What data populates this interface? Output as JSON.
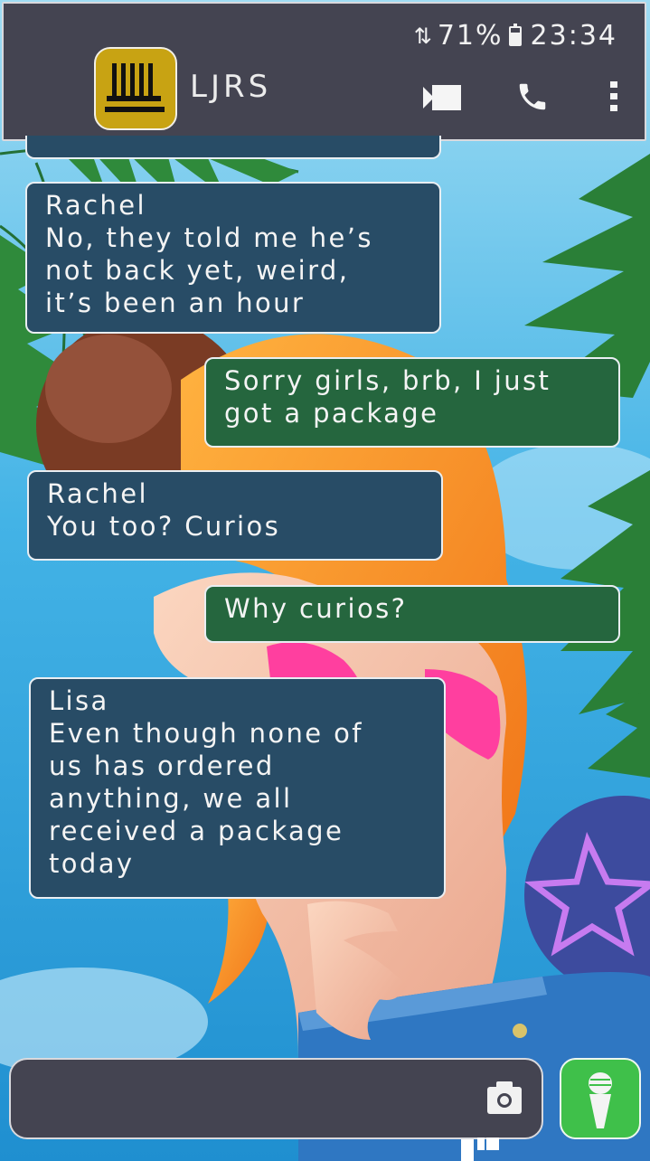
{
  "status_bar": {
    "battery_percent": "71%",
    "time": "23:34",
    "icons": [
      "signal-arrows-icon",
      "battery-icon"
    ]
  },
  "header": {
    "contact_name": "LJRS",
    "avatar_icon": "comb-logo-icon",
    "actions": [
      "video-call-icon",
      "phone-icon",
      "more-vert-icon"
    ]
  },
  "messages": [
    {
      "from": "them",
      "sender": "Rachel",
      "text": "No, they told me he’s\nnot back yet, weird,\nit’s been an hour"
    },
    {
      "from": "me",
      "sender": "",
      "text": "Sorry girls, brb, I just\ngot a package"
    },
    {
      "from": "them",
      "sender": "Rachel",
      "text": "You too? Curios"
    },
    {
      "from": "me",
      "sender": "",
      "text": "Why curios?"
    },
    {
      "from": "them",
      "sender": "Lisa",
      "text": "Even though none of\nus has ordered\nanything, we all\nreceived a package\ntoday"
    }
  ],
  "composer": {
    "input_value": "",
    "camera_icon": "camera-icon",
    "mic_icon": "microphone-icon"
  },
  "colors": {
    "header_bg": "#444451",
    "incoming_bubble": "#284c66",
    "outgoing_bubble": "#25663e",
    "mic_button": "#3fc04a",
    "avatar_gold": "#c8a313"
  }
}
